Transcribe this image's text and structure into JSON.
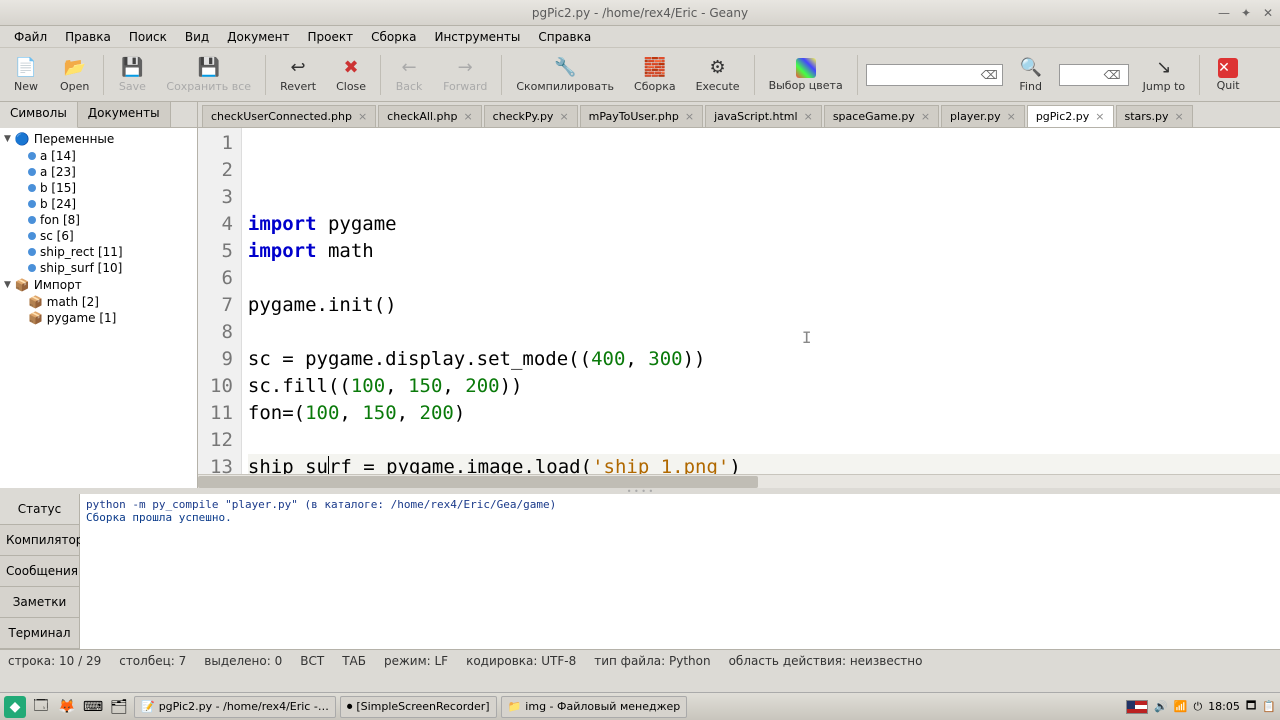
{
  "title": "pgPic2.py - /home/rex4/Eric - Geany",
  "menu": [
    "Файл",
    "Правка",
    "Поиск",
    "Вид",
    "Документ",
    "Проект",
    "Сборка",
    "Инструменты",
    "Справка"
  ],
  "toolbar": {
    "new": "New",
    "open": "Open",
    "save": "Save",
    "saveall": "Сохранить все",
    "revert": "Revert",
    "close": "Close",
    "back": "Back",
    "forward": "Forward",
    "compile": "Скомпилировать",
    "build": "Сборка",
    "execute": "Execute",
    "color": "Выбор цвета",
    "find": "Find",
    "jumpto": "Jump to",
    "quit": "Quit"
  },
  "sidebar_tabs": {
    "symbols": "Символы",
    "documents": "Документы"
  },
  "symbols": {
    "vars_label": "Переменные",
    "vars": [
      "a [14]",
      "a [23]",
      "b [15]",
      "b [24]",
      "fon [8]",
      "sc [6]",
      "ship_rect [11]",
      "ship_surf [10]"
    ],
    "import_label": "Импорт",
    "imports": [
      "math [2]",
      "pygame [1]"
    ]
  },
  "filetabs": [
    "checkUserConnected.php",
    "checkAll.php",
    "checkPy.py",
    "mPayToUser.php",
    "javaScript.html",
    "spaceGame.py",
    "player.py",
    "pgPic2.py",
    "stars.py"
  ],
  "active_tab": 7,
  "code_lines": 13,
  "messages": {
    "tabs": [
      "Статус",
      "Компилятор",
      "Сообщения",
      "Заметки",
      "Терминал"
    ],
    "line1": "python -m py_compile \"player.py\" (в каталоге: /home/rex4/Eric/Gea/game)",
    "line2": "Сборка прошла успешно."
  },
  "status": {
    "line": "строка: 10 / 29",
    "col": "столбец: 7",
    "sel": "выделено: 0",
    "ins": "ВСТ",
    "tab": "ТАБ",
    "mode": "режим: LF",
    "enc": "кодировка: UTF-8",
    "ftype": "тип файла: Python",
    "scope": "область действия: неизвестно"
  },
  "taskbar": {
    "tasks": [
      "pgPic2.py - /home/rex4/Eric -…",
      "[SimpleScreenRecorder]",
      "img - Файловый менеджер"
    ],
    "time": "18:05"
  }
}
